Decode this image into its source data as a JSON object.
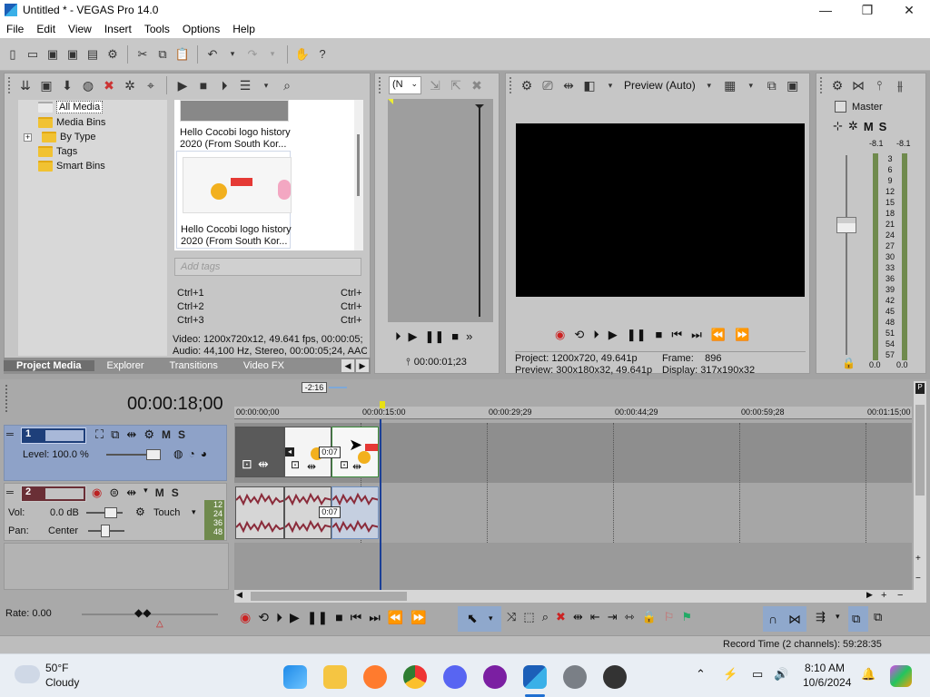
{
  "window": {
    "title": "Untitled * - VEGAS Pro 14.0"
  },
  "menu": [
    "File",
    "Edit",
    "View",
    "Insert",
    "Tools",
    "Options",
    "Help"
  ],
  "media_tree": [
    "All Media",
    "Media Bins",
    "By Type",
    "Tags",
    "Smart Bins"
  ],
  "media_items": [
    {
      "caption": "Hello Cocobi logo history 2020 (From South Kor..."
    },
    {
      "caption": "Hello Cocobi logo history 2020 (From South Kor..."
    }
  ],
  "tags": {
    "placeholder": "Add tags"
  },
  "shortcuts": [
    {
      "key": "Ctrl+1",
      "right": "Ctrl+"
    },
    {
      "key": "Ctrl+2",
      "right": "Ctrl+"
    },
    {
      "key": "Ctrl+3",
      "right": "Ctrl+"
    }
  ],
  "media_info": {
    "video": "Video: 1200x720x12, 49.641 fps, 00:00:05;",
    "audio": "Audio: 44,100 Hz, Stereo, 00:00:05;24, AAC"
  },
  "left_tabs": [
    "Project Media",
    "Explorer",
    "Transitions",
    "Video FX"
  ],
  "trimmer": {
    "dropdown": "(N",
    "time": "00:00:01;23"
  },
  "preview": {
    "mode": "Preview (Auto)",
    "project_label": "Project:",
    "project": "1200x720, 49.641p",
    "preview_label": "Preview:",
    "preview": "300x180x32, 49.641p",
    "frame_label": "Frame:",
    "frame": "896",
    "display_label": "Display:",
    "display": "317x190x32"
  },
  "master": {
    "title": "Master",
    "peak_left": "-8.1",
    "peak_right": "-8.1",
    "scale": [
      "3",
      "6",
      "9",
      "12",
      "15",
      "18",
      "21",
      "24",
      "27",
      "30",
      "33",
      "36",
      "39",
      "42",
      "45",
      "48",
      "51",
      "54",
      "57"
    ],
    "val_left": "0.0",
    "val_right": "0.0"
  },
  "timeline": {
    "timecode": "00:00:18;00",
    "marker_label": "-2:16",
    "ruler": [
      "00:00:00;00",
      "00:00:15:00",
      "00:00:29;29",
      "00:00:44;29",
      "00:00:59;28",
      "00:01:15;00"
    ]
  },
  "tracks": {
    "video": {
      "number": "1",
      "level": "Level: 100.0 %",
      "clip_label": "0:07"
    },
    "audio": {
      "number": "2",
      "vol_label": "Vol:",
      "vol": "0.0 dB",
      "pan_label": "Pan:",
      "pan": "Center",
      "mode": "Touch",
      "clip_label": "0:07",
      "meter": [
        "12",
        "24",
        "36",
        "48"
      ]
    }
  },
  "rate": "Rate: 0.00",
  "status_bar": "Record Time (2 channels): 59:28:35",
  "taskbar": {
    "weather_temp": "50°F",
    "weather_desc": "Cloudy",
    "time": "8:10 AM",
    "date": "10/6/2024"
  }
}
